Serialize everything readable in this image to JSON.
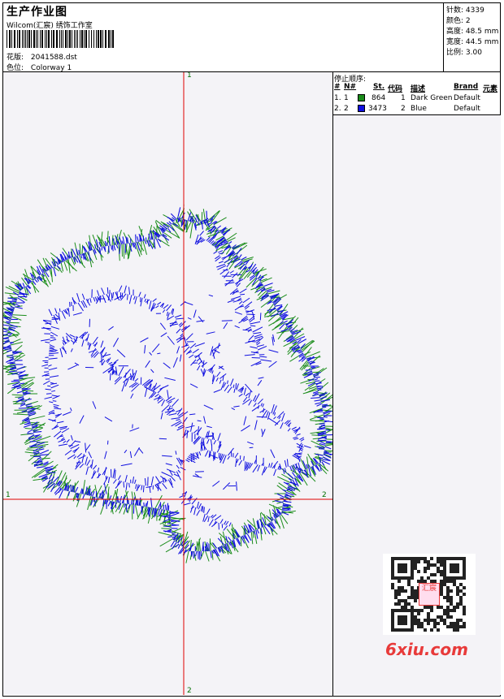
{
  "header": {
    "title": "生产作业图",
    "company": "Wilcom(汇宸) 绣饰工作室",
    "design_label": "花版:",
    "design_file": "2041588.dst",
    "colorway_label": "色位:",
    "colorway": "Colorway 1"
  },
  "stats": [
    {
      "label": "针数:",
      "value": "4339"
    },
    {
      "label": "颜色:",
      "value": "2"
    },
    {
      "label": "高度:",
      "value": "48.5 mm"
    },
    {
      "label": "宽度:",
      "value": "44.5 mm"
    },
    {
      "label": "比例:",
      "value": "3.00"
    }
  ],
  "stop_sequence": {
    "title": "停止顺序:",
    "columns": [
      "#",
      "N#",
      "St.",
      "代码",
      "描述",
      "Brand",
      "元素"
    ],
    "rows": [
      {
        "index": "1.",
        "n": "1",
        "color": "#1a8c1a",
        "stitches": "864",
        "code": "1",
        "description": "Dark Green",
        "brand": "Default"
      },
      {
        "index": "2.",
        "n": "2",
        "color": "#1010e0",
        "stitches": "3473",
        "code": "2",
        "description": "Blue",
        "brand": "Default"
      }
    ]
  },
  "axis_markers": {
    "top": "1",
    "bottom": "2",
    "left": "1",
    "right": "2"
  },
  "colors": {
    "thread_green": "#1a8c1a",
    "thread_blue": "#1010e0",
    "axis_red": "#e00000",
    "watermark_red": "#e83a3a"
  },
  "watermark": {
    "text": "6xiu.com",
    "seal_text": "汇宸"
  }
}
